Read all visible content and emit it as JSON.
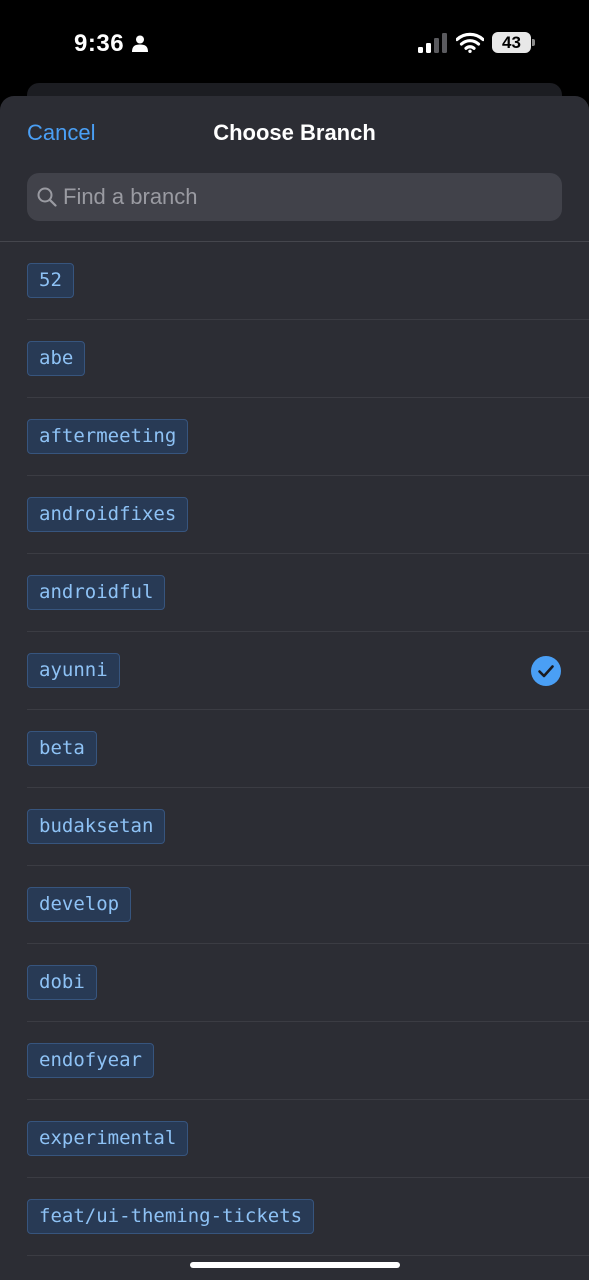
{
  "status": {
    "time": "9:36",
    "battery": "43"
  },
  "nav": {
    "cancel_label": "Cancel",
    "title": "Choose Branch"
  },
  "search": {
    "placeholder": "Find a branch",
    "value": ""
  },
  "branches": [
    {
      "name": "52",
      "selected": false
    },
    {
      "name": "abe",
      "selected": false
    },
    {
      "name": "aftermeeting",
      "selected": false
    },
    {
      "name": "androidfixes",
      "selected": false
    },
    {
      "name": "androidful",
      "selected": false
    },
    {
      "name": "ayunni",
      "selected": true
    },
    {
      "name": "beta",
      "selected": false
    },
    {
      "name": "budaksetan",
      "selected": false
    },
    {
      "name": "develop",
      "selected": false
    },
    {
      "name": "dobi",
      "selected": false
    },
    {
      "name": "endofyear",
      "selected": false
    },
    {
      "name": "experimental",
      "selected": false
    },
    {
      "name": "feat/ui-theming-tickets",
      "selected": false
    }
  ],
  "colors": {
    "accent": "#4a9ff5",
    "sheet_background": "#2c2d34",
    "chip_background": "#283a55",
    "chip_text": "#8ec2f5"
  }
}
